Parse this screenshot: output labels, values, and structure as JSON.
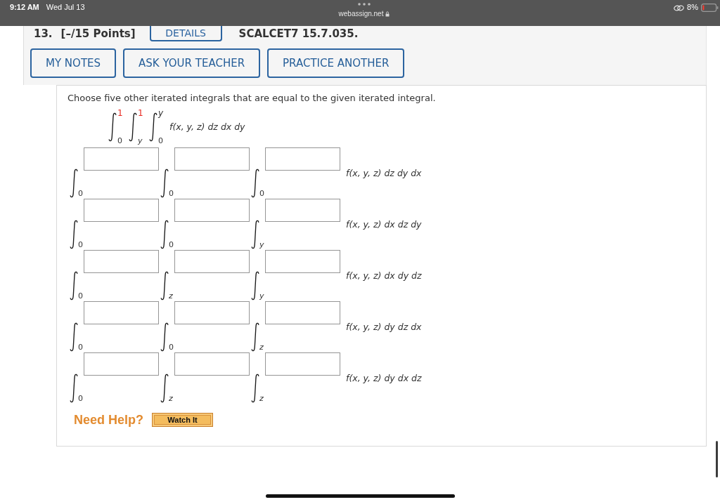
{
  "status_bar": {
    "time": "9:12 AM",
    "date": "Wed Jul 13",
    "url": "webassign.net",
    "battery": "8%"
  },
  "question": {
    "number": "13.",
    "points": "[–/15 Points]",
    "details_button": "DETAILS",
    "code": "SCALCET7 15.7.035.",
    "actions": [
      "MY NOTES",
      "ASK YOUR TEACHER",
      "PRACTICE ANOTHER"
    ]
  },
  "prompt": "Choose five other iterated integrals that are equal to the given iterated integral.",
  "given_integral": {
    "integrals": [
      {
        "lower": {
          "text": "0",
          "italic": false
        },
        "upper": {
          "text": "1",
          "italic": false,
          "color": "#e8261e"
        }
      },
      {
        "lower": {
          "text": "y",
          "italic": true
        },
        "upper": {
          "text": "1",
          "italic": false,
          "color": "#e8261e"
        }
      },
      {
        "lower": {
          "text": "0",
          "italic": false
        },
        "upper": {
          "text": "y",
          "italic": true,
          "color": "#333333"
        }
      }
    ],
    "integrand": "f(x, y, z) dz dx dy"
  },
  "answer_rows": [
    {
      "lower_limits": [
        {
          "text": "0",
          "italic": false
        },
        {
          "text": "0",
          "italic": false
        },
        {
          "text": "0",
          "italic": false
        }
      ],
      "integrand": "f(x, y, z) dz dy dx"
    },
    {
      "lower_limits": [
        {
          "text": "0",
          "italic": false
        },
        {
          "text": "0",
          "italic": false
        },
        {
          "text": "y",
          "italic": true
        }
      ],
      "integrand": "f(x, y, z) dx dz dy"
    },
    {
      "lower_limits": [
        {
          "text": "0",
          "italic": false
        },
        {
          "text": "z",
          "italic": true
        },
        {
          "text": "y",
          "italic": true
        }
      ],
      "integrand": "f(x, y, z) dx dy dz"
    },
    {
      "lower_limits": [
        {
          "text": "0",
          "italic": false
        },
        {
          "text": "0",
          "italic": false
        },
        {
          "text": "z",
          "italic": true
        }
      ],
      "integrand": "f(x, y, z) dy dz dx"
    },
    {
      "lower_limits": [
        {
          "text": "0",
          "italic": false
        },
        {
          "text": "z",
          "italic": true
        },
        {
          "text": "z",
          "italic": true
        }
      ],
      "integrand": "f(x, y, z) dy dx dz"
    }
  ],
  "help": {
    "label": "Need Help?",
    "button": "Watch It"
  }
}
